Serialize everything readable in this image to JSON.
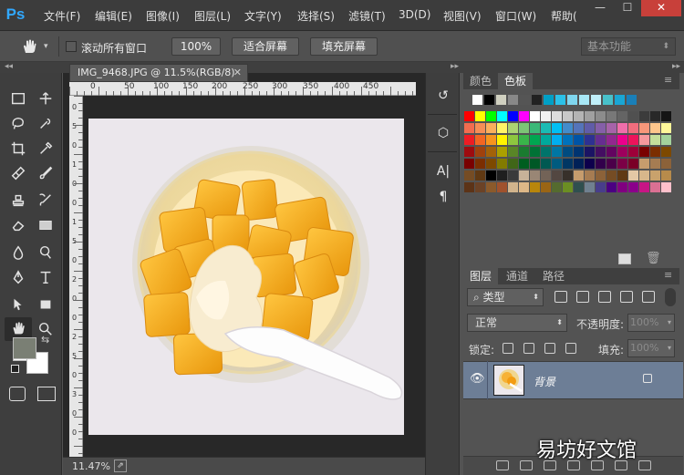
{
  "app": {
    "logo": "Ps"
  },
  "menu": [
    "文件(F)",
    "编辑(E)",
    "图像(I)",
    "图层(L)",
    "文字(Y)",
    "选择(S)",
    "滤镜(T)",
    "3D(D)",
    "视图(V)",
    "窗口(W)",
    "帮助("
  ],
  "window_controls": {
    "minimize": "—",
    "restore": "☐",
    "close": "✕"
  },
  "options": {
    "scroll_all_label": "滚动所有窗口",
    "zoom100": "100%",
    "fit_screen": "适合屏幕",
    "fill_screen": "填充屏幕",
    "workspace": "基本功能"
  },
  "document": {
    "tab_title": "IMG_9468.JPG @ 11.5%(RGB/8)",
    "zoom_status": "11.47%"
  },
  "ruler": {
    "top_ticks": [
      "0",
      "50",
      "100",
      "150",
      "200",
      "250",
      "300",
      "350",
      "400",
      "450"
    ],
    "left_ticks": [
      "0",
      "5",
      "0",
      "1",
      "0",
      "0",
      "1",
      "5",
      "0",
      "2",
      "0",
      "0",
      "2",
      "5",
      "0",
      "3",
      "0",
      "0"
    ]
  },
  "color_panel": {
    "tabs": [
      "颜色",
      "色板"
    ],
    "active_tab": "色板"
  },
  "layers_panel": {
    "tabs": [
      "图层",
      "通道",
      "路径"
    ],
    "filter_kind": "类型",
    "blend_mode": "正常",
    "opacity_label": "不透明度:",
    "opacity_value": "100%",
    "lock_label": "锁定:",
    "fill_label": "填充:",
    "fill_value": "100%"
  },
  "layer": {
    "name": "背景"
  },
  "watermark": "易坊好文馆",
  "colors": {
    "foreground": "#7a7f74",
    "background": "#ffffff",
    "accent": "#31a8ff",
    "selected_layer": "#6d7e96"
  }
}
